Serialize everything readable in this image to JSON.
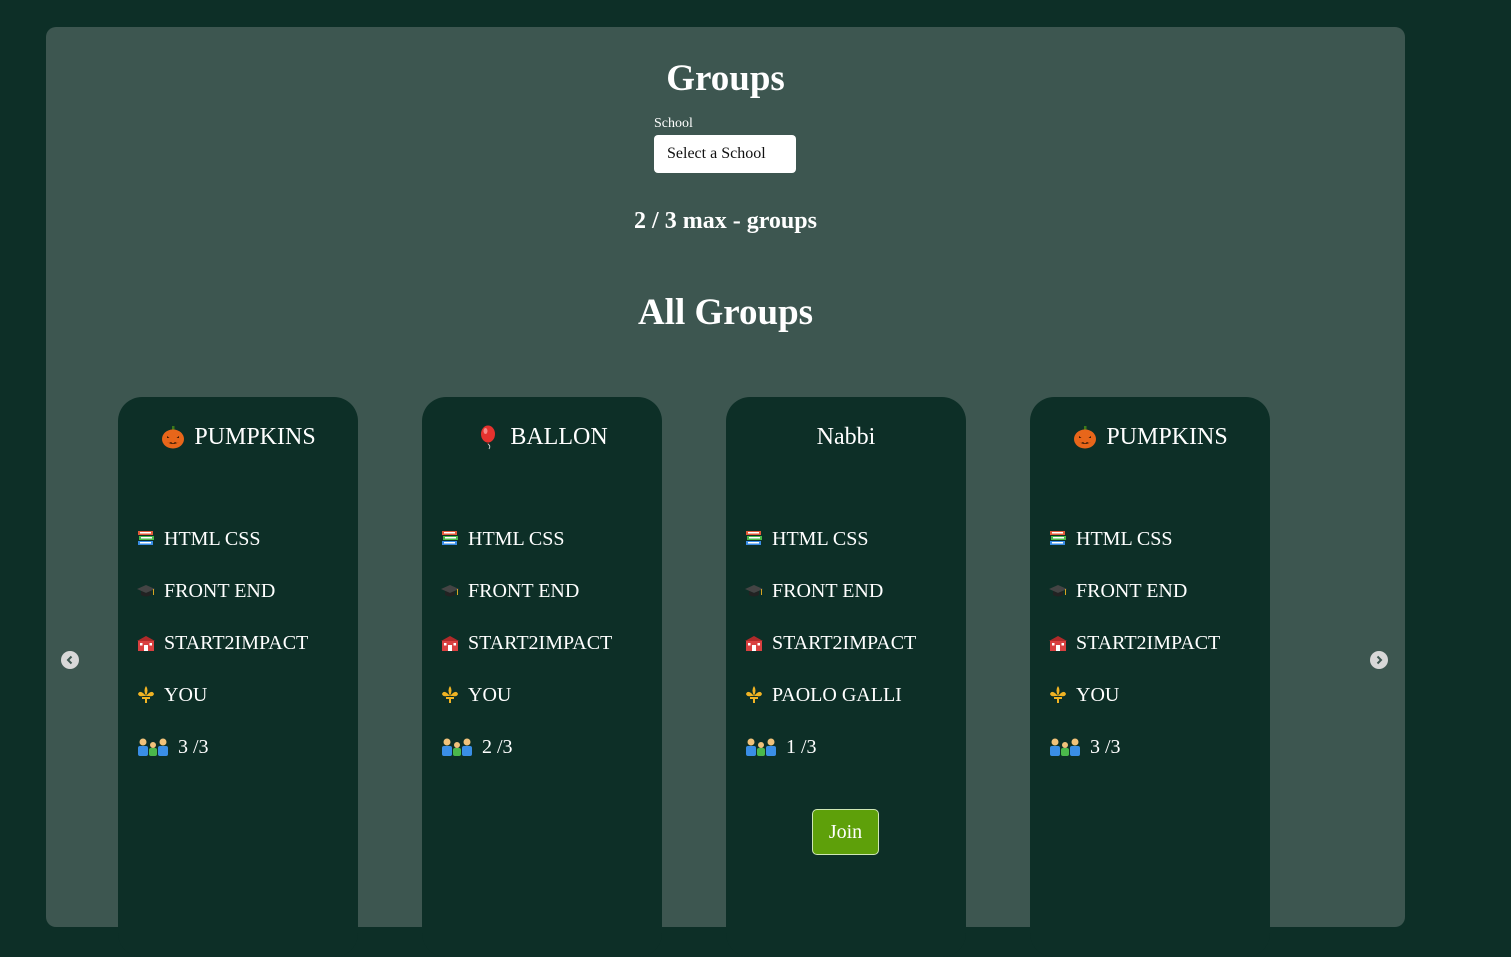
{
  "header": {
    "title": "Groups",
    "school_label": "School",
    "school_select_value": "Select a School",
    "max_groups": "2 / 3 max - groups",
    "all_groups_title": "All Groups"
  },
  "colors": {
    "page_bg": "#0d2f27",
    "panel_bg": "#3d5650",
    "card_bg": "#0d2f27",
    "join_button": "#5ea00a"
  },
  "cards": [
    {
      "title_icon": "pumpkin-icon",
      "title": "PUMPKINS",
      "course": "HTML CSS",
      "track": "FRONT END",
      "school": "START2IMPACT",
      "owner": "YOU",
      "members": "3 /3",
      "join_label": ""
    },
    {
      "title_icon": "balloon-icon",
      "title": "BALLON",
      "course": "HTML CSS",
      "track": "FRONT END",
      "school": "START2IMPACT",
      "owner": "YOU",
      "members": "2 /3",
      "join_label": ""
    },
    {
      "title_icon": "",
      "title": "Nabbi",
      "course": "HTML CSS",
      "track": "FRONT END",
      "school": "START2IMPACT",
      "owner": "PAOLO GALLI",
      "members": "1 /3",
      "join_label": "Join"
    },
    {
      "title_icon": "pumpkin-icon",
      "title": "PUMPKINS",
      "course": "HTML CSS",
      "track": "FRONT END",
      "school": "START2IMPACT",
      "owner": "YOU",
      "members": "3 /3",
      "join_label": ""
    }
  ],
  "icons": {
    "course": "books-icon",
    "track": "graduation-cap-icon",
    "school": "school-building-icon",
    "owner": "fleur-de-lis-icon",
    "members": "family-icon",
    "prev": "chevron-left-icon",
    "next": "chevron-right-icon"
  }
}
